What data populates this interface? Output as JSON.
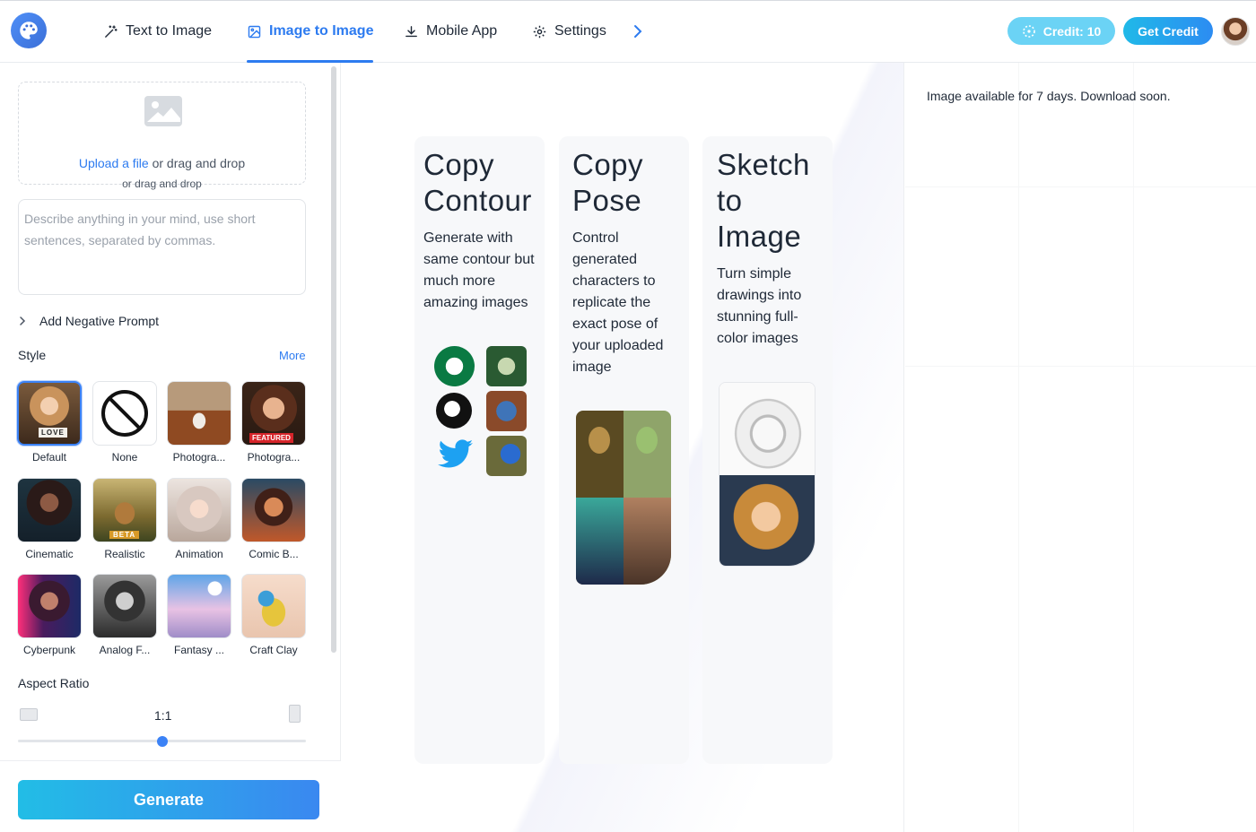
{
  "header": {
    "tabs": [
      {
        "label": "Text to Image",
        "icon": "magic-wand-icon",
        "active": false
      },
      {
        "label": "Image to Image",
        "icon": "image-icon",
        "active": true
      },
      {
        "label": "Mobile App",
        "icon": "download-icon",
        "active": false
      },
      {
        "label": "Settings",
        "icon": "gear-icon",
        "active": false
      }
    ],
    "credit_label": "Credit: 10",
    "get_credit_label": "Get Credit"
  },
  "upload": {
    "link_text": "Upload a file",
    "main_rest": " or drag and drop",
    "sub_text": "or drag and drop"
  },
  "prompt": {
    "placeholder": "Describe anything in your mind, use short sentences, separated by commas."
  },
  "negative_prompt_label": "Add Negative Prompt",
  "style": {
    "title": "Style",
    "more_label": "More",
    "items": [
      {
        "label": "Default",
        "selected": true,
        "badge": "LOVE"
      },
      {
        "label": "None",
        "selected": false
      },
      {
        "label": "Photogra...",
        "selected": false
      },
      {
        "label": "Photogra...",
        "selected": false,
        "badge": "FEATURED"
      },
      {
        "label": "Cinematic",
        "selected": false
      },
      {
        "label": "Realistic",
        "selected": false,
        "badge": "BETA"
      },
      {
        "label": "Animation",
        "selected": false
      },
      {
        "label": "Comic B...",
        "selected": false
      },
      {
        "label": "Cyberpunk",
        "selected": false
      },
      {
        "label": "Analog F...",
        "selected": false
      },
      {
        "label": "Fantasy ...",
        "selected": false
      },
      {
        "label": "Craft Clay",
        "selected": false
      }
    ]
  },
  "aspect_ratio": {
    "title": "Aspect Ratio",
    "value": "1:1",
    "slider_fraction": 0.5
  },
  "generate_label": "Generate",
  "cards": [
    {
      "title": "Copy Contour",
      "description": "Generate with same contour but much more amazing images"
    },
    {
      "title": "Copy Pose",
      "description": "Control generated characters to replicate the exact pose of your uploaded image"
    },
    {
      "title": "Sketch to Image",
      "description": "Turn simple drawings into stunning full-color images"
    }
  ],
  "right_panel": {
    "message": "Image available for 7 days. Download soon."
  },
  "colors": {
    "accent": "#2d7bf0",
    "credit_bg": "#6bd3f5",
    "generate_gradient_start": "#22bde6",
    "generate_gradient_end": "#3a88f0"
  }
}
